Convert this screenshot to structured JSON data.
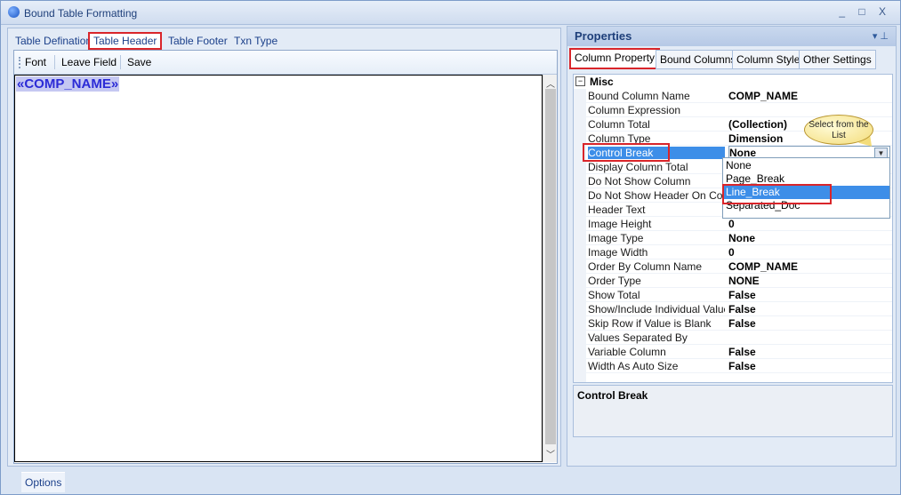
{
  "window": {
    "title": "Bound Table Formatting",
    "controls": "_ □ X"
  },
  "left_tabs": [
    "Table Defination",
    "Table Header",
    "Table Footer",
    "Txn Type"
  ],
  "toolbar": {
    "font_label": "Font",
    "leave_field_label": "Leave Field",
    "save_label": "Save"
  },
  "editor": {
    "field_tag": "«COMP_NAME»"
  },
  "bottom": {
    "options_label": "Options"
  },
  "properties": {
    "title": "Properties",
    "pin_controls": "▾ ⊥",
    "tabs": [
      "Column Property",
      "Bound Columns",
      "Column Style",
      "Other Settings"
    ],
    "category": "Misc",
    "rows": [
      {
        "name": "Bound Column Name",
        "value": "COMP_NAME"
      },
      {
        "name": "Column Expression",
        "value": ""
      },
      {
        "name": "Column Total",
        "value": "(Collection)"
      },
      {
        "name": "Column Type",
        "value": "Dimension"
      },
      {
        "name": "Control Break",
        "value": "None"
      },
      {
        "name": "Display Column Total",
        "value": ""
      },
      {
        "name": "Do Not Show Column",
        "value": ""
      },
      {
        "name": "Do Not Show Header On Contr",
        "value": ""
      },
      {
        "name": "Header Text",
        "value": ""
      },
      {
        "name": "Image Height",
        "value": "0"
      },
      {
        "name": "Image Type",
        "value": "None"
      },
      {
        "name": "Image Width",
        "value": "0"
      },
      {
        "name": "Order By Column Name",
        "value": "COMP_NAME"
      },
      {
        "name": "Order Type",
        "value": "NONE"
      },
      {
        "name": "Show Total",
        "value": "False"
      },
      {
        "name": "Show/Include Individual Values",
        "value": "False"
      },
      {
        "name": "Skip Row if Value is Blank",
        "value": "False"
      },
      {
        "name": "Values Separated By",
        "value": ""
      },
      {
        "name": "Variable Column",
        "value": "False"
      },
      {
        "name": "Width As Auto Size",
        "value": "False"
      }
    ],
    "dropdown_options": [
      "None",
      "Page_Break",
      "Line_Break",
      "Separated_Doc"
    ],
    "callout": "Select from the List",
    "description_title": "Control Break"
  },
  "colors": {
    "highlight_red": "#d9252a",
    "selection_blue": "#3d8ee8",
    "field_tag_blue": "#2b2bd6"
  }
}
